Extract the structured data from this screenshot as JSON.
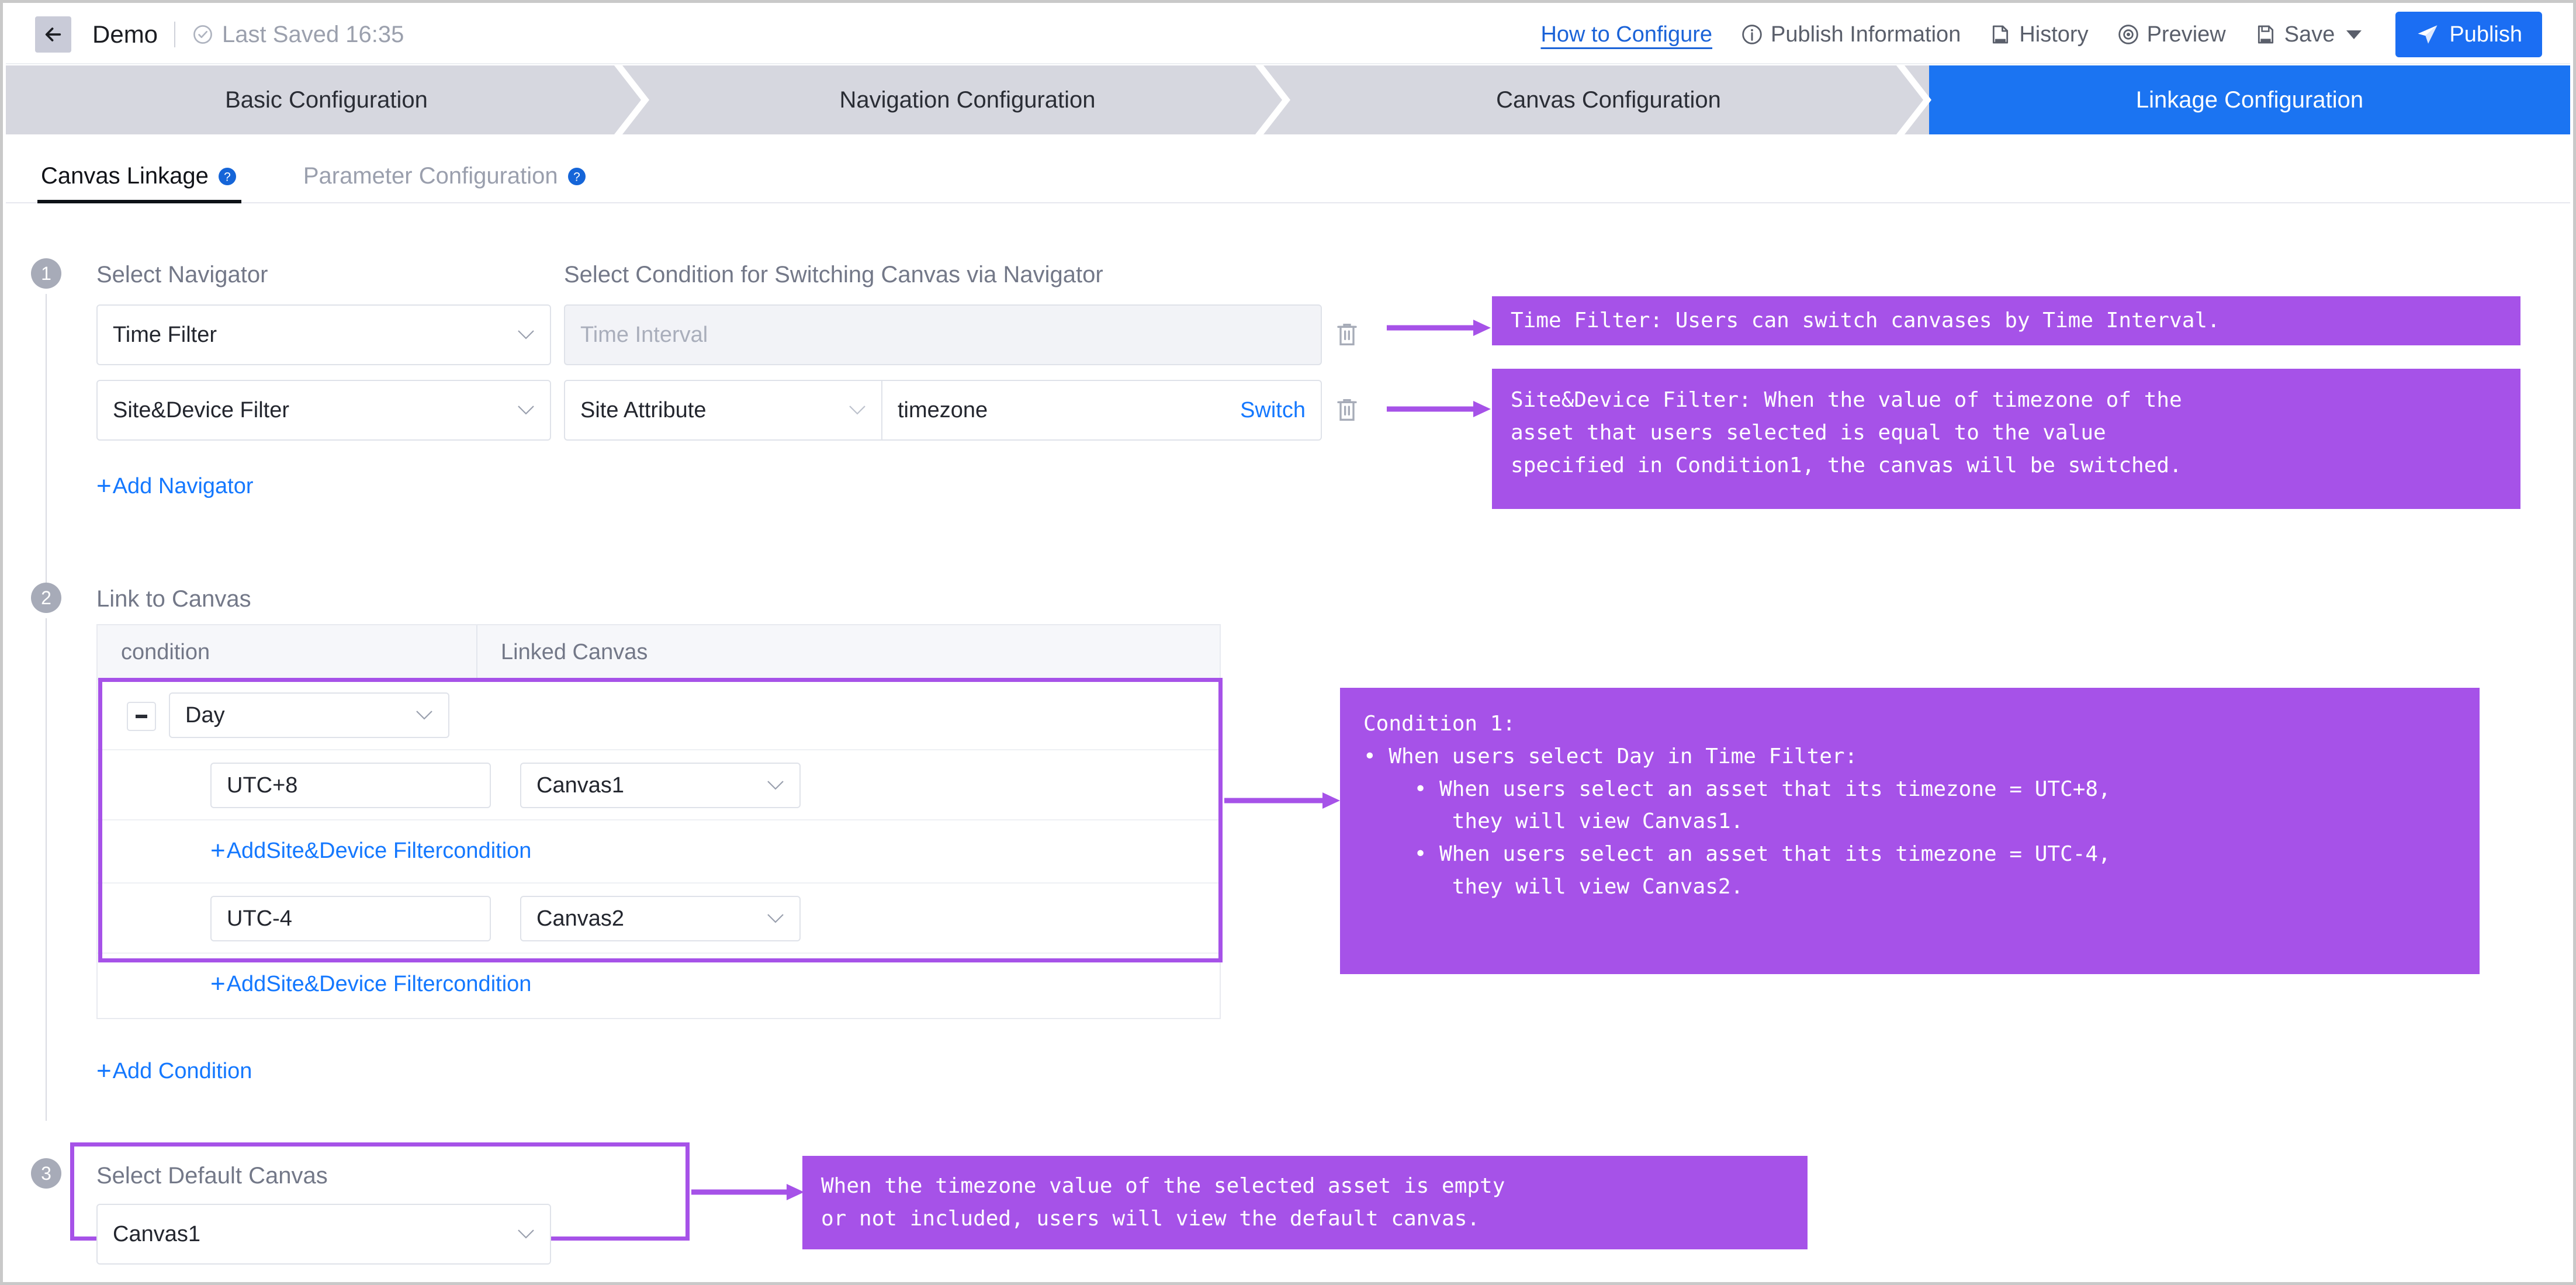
{
  "header": {
    "back_icon": "arrow-left-icon",
    "doc_title": "Demo",
    "saved_icon": "clock-check-icon",
    "saved_text": "Last Saved 16:35",
    "how_to_configure": "How to Configure",
    "publish_information": "Publish Information",
    "history": "History",
    "preview": "Preview",
    "save": "Save",
    "publish": "Publish"
  },
  "steps": [
    {
      "label": "Basic Configuration",
      "active": false
    },
    {
      "label": "Navigation Configuration",
      "active": false
    },
    {
      "label": "Canvas Configuration",
      "active": false
    },
    {
      "label": "Linkage Configuration",
      "active": true
    }
  ],
  "tabs": [
    {
      "label": "Canvas Linkage",
      "active": true
    },
    {
      "label": "Parameter Configuration",
      "active": false
    }
  ],
  "step1": {
    "number": "1",
    "col1_label": "Select Navigator",
    "col2_label": "Select Condition for Switching Canvas via Navigator",
    "rows": [
      {
        "navigator": "Time Filter",
        "condition_placeholder": "Time Interval",
        "attribute": null,
        "value": null,
        "switch_label": null
      },
      {
        "navigator": "Site&Device Filter",
        "condition_placeholder": null,
        "attribute": "Site Attribute",
        "value": "timezone",
        "switch_label": "Switch"
      }
    ],
    "add_navigator": "Add Navigator"
  },
  "step2": {
    "number": "2",
    "label": "Link to Canvas",
    "columns": [
      "condition",
      "Linked Canvas"
    ],
    "group": {
      "condition_value": "Day",
      "rows": [
        {
          "value": "UTC+8",
          "canvas": "Canvas1"
        },
        {
          "value": "UTC-4",
          "canvas": "Canvas2"
        }
      ],
      "add_inner_label": "AddSite&Device Filtercondition"
    },
    "add_outer_label": "AddSite&Device Filtercondition",
    "add_condition": "Add Condition"
  },
  "step3": {
    "number": "3",
    "label": "Select Default Canvas",
    "value": "Canvas1"
  },
  "annotations": {
    "time_filter": "Time Filter: Users can switch canvases by Time Interval.",
    "site_device_filter": "Site&Device Filter: When the value of timezone of the\nasset that users selected is equal to the value\nspecified in Condition1, the canvas will be switched.",
    "condition1": "Condition 1:\n• When users select Day in Time Filter:\n    • When users select an asset that its timezone = UTC+8,\n       they will view Canvas1.\n    • When users select an asset that its timezone = UTC-4,\n       they will view Canvas2.",
    "default_canvas": "When the timezone value of the selected asset is empty\nor not included, users will view the default canvas."
  },
  "colors": {
    "accent_blue": "#1B6EF3",
    "link_blue": "#1478FF",
    "annotation_purple": "#A652E8",
    "step_inactive": "#D6D7DF"
  }
}
